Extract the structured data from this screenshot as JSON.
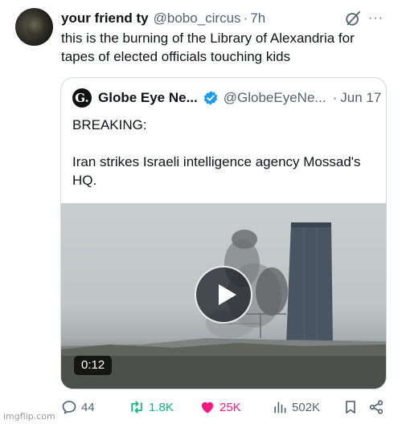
{
  "post": {
    "display_name": "your friend ty",
    "handle": "@bobo_circus",
    "separator": "·",
    "time": "7h",
    "text": "this is the burning of the Library of Alexandria for tapes of elected officials touching kids",
    "more_label": "···"
  },
  "quote": {
    "avatar_letter": "G.",
    "display_name": "Globe Eye Ne...",
    "handle": "@GlobeEyeNe...",
    "separator": "·",
    "date": "Jun 17",
    "text": "BREAKING:\n\nIran strikes Israeli intelligence agency Mossad's HQ.",
    "video_duration": "0:12"
  },
  "actions": {
    "replies": "44",
    "reposts": "1.8K",
    "likes": "25K",
    "views": "502K"
  },
  "colors": {
    "text": "#0f1419",
    "secondary": "#536471",
    "repost_active": "#00ba7c",
    "like_active": "#f91880",
    "verified": "#1d9bf0"
  },
  "watermark": "imgflip.com"
}
